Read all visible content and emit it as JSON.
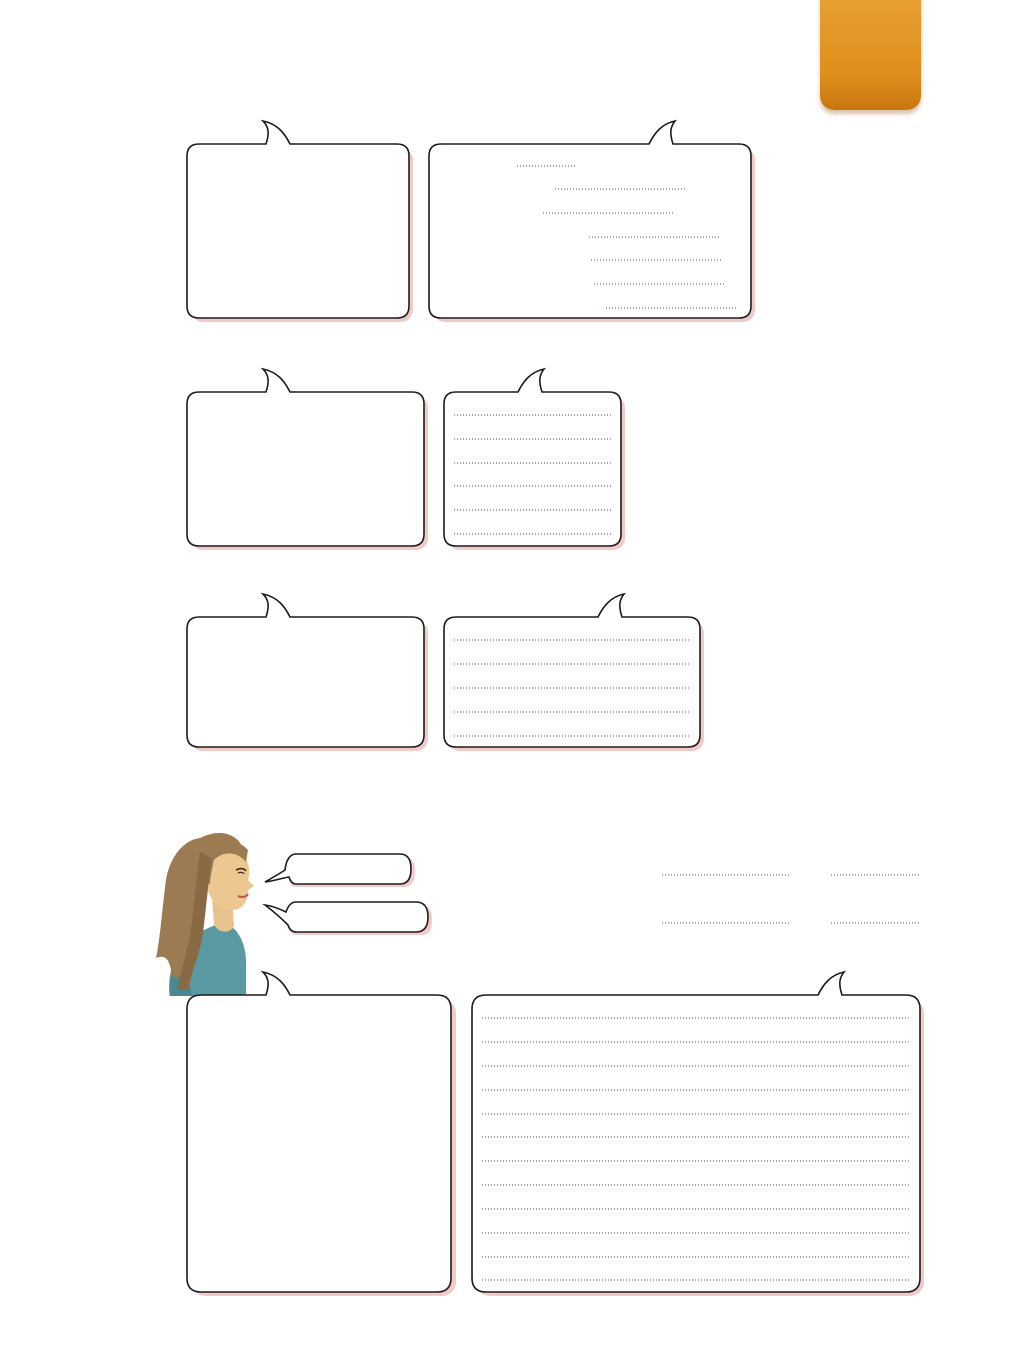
{
  "page": {
    "accent_color": "#e0951f",
    "bubble_shadow_color": "#f3c9c6"
  },
  "bubbles": [
    {
      "id": "row1-left",
      "kind": "empty",
      "lines": 0
    },
    {
      "id": "row1-right",
      "kind": "staggered-blanks",
      "lines": 7
    },
    {
      "id": "row2-left",
      "kind": "empty",
      "lines": 0
    },
    {
      "id": "row2-right",
      "kind": "ruled",
      "lines": 6
    },
    {
      "id": "row3-left",
      "kind": "empty",
      "lines": 0
    },
    {
      "id": "row3-right",
      "kind": "ruled",
      "lines": 5
    },
    {
      "id": "row4-left",
      "kind": "empty",
      "lines": 0
    },
    {
      "id": "row4-right",
      "kind": "ruled",
      "lines": 12
    }
  ],
  "speaker": {
    "illustration": "woman-portrait",
    "speech_bubbles": 2
  },
  "answer_blanks": {
    "rows": 2,
    "columns": 2
  }
}
